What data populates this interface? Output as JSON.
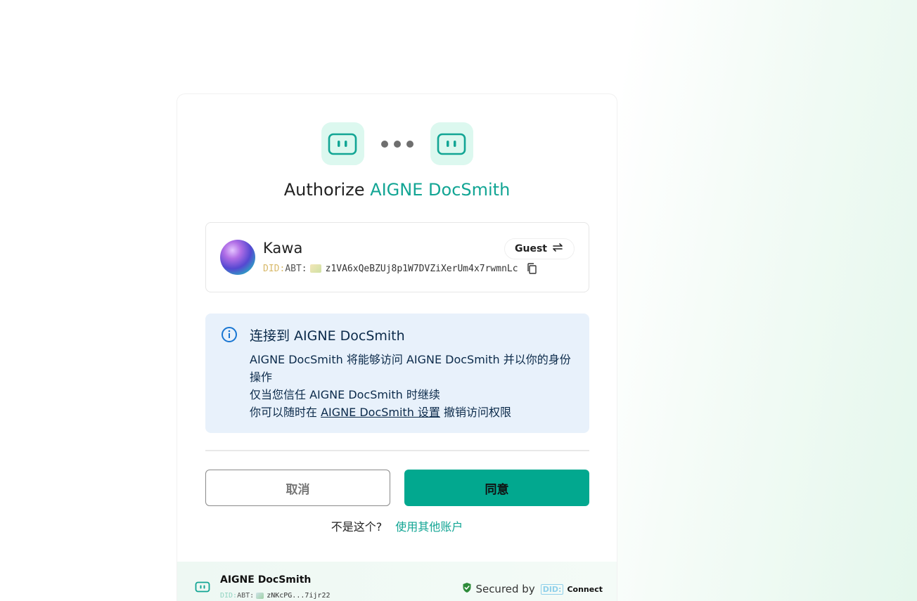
{
  "header": {
    "title_prefix": "Authorize",
    "app_name": "AIGNE DocSmith"
  },
  "user": {
    "name": "Kawa",
    "role_badge": "Guest",
    "did_prefix": "DID:",
    "did_type": "ABT:",
    "did_value": "z1VA6xQeBZUj8p1W7DVZiXerUm4x7rwmnLc"
  },
  "info": {
    "title": "连接到 AIGNE DocSmith",
    "line1": "AIGNE DocSmith 将能够访问 AIGNE DocSmith 并以你的身份操作",
    "line2": "仅当您信任 AIGNE DocSmith 时继续",
    "line3_prefix": "你可以随时在",
    "line3_link": "AIGNE DocSmith 设置",
    "line3_suffix": "撤销访问权限"
  },
  "actions": {
    "cancel_label": "取消",
    "agree_label": "同意",
    "switch_prompt": "不是这个?",
    "switch_link": "使用其他账户"
  },
  "footer": {
    "app_name": "AIGNE DocSmith",
    "did_prefix": "DID:",
    "did_type": "ABT:",
    "did_value": "zNKcPG...7ijr22",
    "secured_label": "Secured by",
    "did_badge": "DID:",
    "connect_label": "Connect"
  },
  "colors": {
    "accent": "#12a594",
    "primary_button": "#02a88f",
    "info_background": "#e8f1fb"
  },
  "icons": {
    "app_logo": "app-logo-icon",
    "info": "info-icon",
    "copy": "copy-icon",
    "switch": "switch-arrows-icon",
    "shield": "shield-check-icon"
  }
}
